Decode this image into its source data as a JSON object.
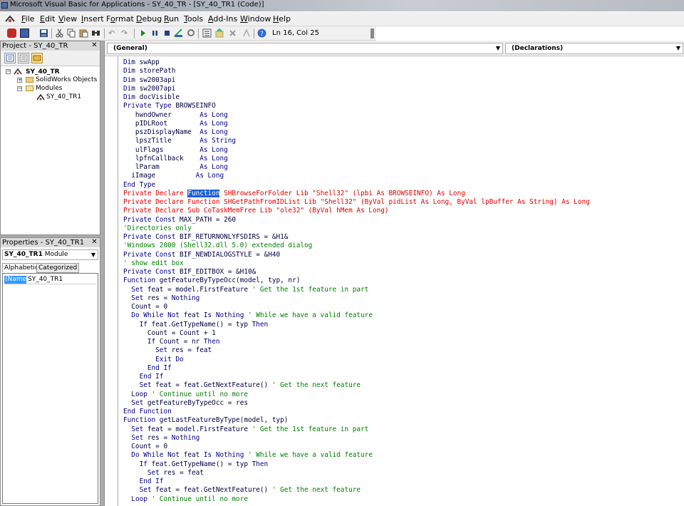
{
  "window": {
    "title": "Microsoft Visual Basic for Applications - SY_40_TR - [SY_40_TR1 (Code)]"
  },
  "menu": [
    {
      "label": "File",
      "underline": "F",
      "rest": "ile"
    },
    {
      "label": "Edit",
      "underline": "E",
      "rest": "dit"
    },
    {
      "label": "View",
      "underline": "V",
      "rest": "iew"
    },
    {
      "label": "Insert",
      "underline": "I",
      "rest": "nsert"
    },
    {
      "label": "Format",
      "underline": "o",
      "rest": ""
    },
    {
      "label": "Debug",
      "underline": "D",
      "rest": "ebug"
    },
    {
      "label": "Run",
      "underline": "R",
      "rest": "un"
    },
    {
      "label": "Tools",
      "underline": "T",
      "rest": "ools"
    },
    {
      "label": "Add-Ins",
      "underline": "A",
      "rest": "dd-Ins"
    },
    {
      "label": "Window",
      "underline": "W",
      "rest": "indow"
    },
    {
      "label": "Help",
      "underline": "H",
      "rest": "elp"
    }
  ],
  "toolbar": {
    "cursor_position": "Ln 16, Col 25",
    "icons": [
      "solidworks-icon",
      "view-object-icon",
      "save-icon",
      "cut-icon",
      "copy-icon",
      "paste-icon",
      "find-icon",
      "undo-icon",
      "redo-icon",
      "run-icon",
      "break-icon",
      "reset-icon",
      "design-mode-icon",
      "project-explorer-icon",
      "properties-icon",
      "object-browser-icon",
      "toolbox-icon",
      "help-icon"
    ]
  },
  "project_pane": {
    "title": "Project - SY_40_TR",
    "tree": {
      "root": "SY_40_TR",
      "solidworks_objects": "SolidWorks Objects",
      "modules": "Modules",
      "module_item": "SY_40_TR1"
    }
  },
  "properties_pane": {
    "title": "Properties - SY_40_TR1",
    "object_name": "SY_40_TR1",
    "object_type": " Module",
    "tabs": [
      "Alphabetic",
      "Categorized"
    ],
    "property_name": "(Name)",
    "property_value": "SY_40_TR1"
  },
  "code_window": {
    "object_combo": "(General)",
    "procedure_combo": "(Declarations)",
    "lines": [
      [
        {
          "t": "Dim",
          "c": "kw"
        },
        {
          "t": " swApp"
        }
      ],
      [
        {
          "t": "Dim",
          "c": "kw"
        },
        {
          "t": " storePath"
        }
      ],
      [
        {
          "t": "Dim",
          "c": "kw"
        },
        {
          "t": " sw2003api"
        }
      ],
      [
        {
          "t": "Dim",
          "c": "kw"
        },
        {
          "t": " sw2007api"
        }
      ],
      [
        {
          "t": "Dim",
          "c": "kw"
        },
        {
          "t": " docVisible"
        }
      ],
      [
        {
          "t": "Private Type",
          "c": "kw"
        },
        {
          "t": " BROWSEINFO"
        }
      ],
      [
        {
          "t": "   hwndOwner       "
        },
        {
          "t": "As Long",
          "c": "kw"
        }
      ],
      [
        {
          "t": "   pIDLRoot        "
        },
        {
          "t": "As Long",
          "c": "kw"
        }
      ],
      [
        {
          "t": "   pszDisplayName  "
        },
        {
          "t": "As Long",
          "c": "kw"
        }
      ],
      [
        {
          "t": "   lpszTitle       "
        },
        {
          "t": "As String",
          "c": "kw"
        }
      ],
      [
        {
          "t": "   ulFlags         "
        },
        {
          "t": "As Long",
          "c": "kw"
        }
      ],
      [
        {
          "t": "   lpfnCallback    "
        },
        {
          "t": "As Long",
          "c": "kw"
        }
      ],
      [
        {
          "t": "   lParam          "
        },
        {
          "t": "As Long",
          "c": "kw"
        }
      ],
      [
        {
          "t": "  iImage          "
        },
        {
          "t": "As Long",
          "c": "kw"
        }
      ],
      [
        {
          "t": "End Type",
          "c": "kw"
        }
      ],
      [
        {
          "t": "Private Declare ",
          "c": "er"
        },
        {
          "t": "Function",
          "c": "sel"
        },
        {
          "t": " SHBrowseForFolder Lib \"Shell32\" (lpbi As BROWSEINFO) As Long",
          "c": "er"
        }
      ],
      [
        {
          "t": "Private Declare Function SHGetPathFromIDList Lib \"Shell32\" (ByVal pidList As Long, ByVal lpBuffer As String) As Long",
          "c": "er"
        }
      ],
      [
        {
          "t": "Private Declare Sub CoTaskMemFree Lib \"ole32\" (ByVal hMem As Long)",
          "c": "er"
        }
      ],
      [
        {
          "t": "Private Const",
          "c": "kw"
        },
        {
          "t": " MAX_PATH = 260"
        }
      ],
      [
        {
          "t": "'Directories only",
          "c": "cm"
        }
      ],
      [
        {
          "t": "Private Const",
          "c": "kw"
        },
        {
          "t": " BIF_RETURNONLYFSDIRS = &H1&"
        }
      ],
      [
        {
          "t": "'Windows 2000 (Shell32.dll 5.0) extended dialog",
          "c": "cm"
        }
      ],
      [
        {
          "t": "Private Const",
          "c": "kw"
        },
        {
          "t": " BIF_NEWDIALOGSTYLE = &H40"
        }
      ],
      [
        {
          "t": "' show edit box",
          "c": "cm"
        }
      ],
      [
        {
          "t": "Private Const",
          "c": "kw"
        },
        {
          "t": " BIF_EDITBOX = &H10&"
        }
      ],
      [
        {
          "t": "Function",
          "c": "kw"
        },
        {
          "t": " getFeatureByTypeOcc(model, typ, nr)"
        }
      ],
      [
        {
          "t": "  "
        },
        {
          "t": "Set",
          "c": "kw"
        },
        {
          "t": " feat = model.FirstFeature "
        },
        {
          "t": "' Get the 1st feature in part",
          "c": "cm"
        }
      ],
      [
        {
          "t": "  "
        },
        {
          "t": "Set",
          "c": "kw"
        },
        {
          "t": " res = "
        },
        {
          "t": "Nothing",
          "c": "kw"
        }
      ],
      [
        {
          "t": "  Count = 0"
        }
      ],
      [
        {
          "t": "  "
        },
        {
          "t": "Do While Not",
          "c": "kw"
        },
        {
          "t": " feat "
        },
        {
          "t": "Is Nothing",
          "c": "kw"
        },
        {
          "t": " ' While we have a valid feature",
          "c": "cm"
        }
      ],
      [
        {
          "t": "    "
        },
        {
          "t": "If",
          "c": "kw"
        },
        {
          "t": " feat.GetTypeName() = typ "
        },
        {
          "t": "Then",
          "c": "kw"
        }
      ],
      [
        {
          "t": "      Count = Count + 1"
        }
      ],
      [
        {
          "t": "      "
        },
        {
          "t": "If",
          "c": "kw"
        },
        {
          "t": " Count = nr "
        },
        {
          "t": "Then",
          "c": "kw"
        }
      ],
      [
        {
          "t": "        "
        },
        {
          "t": "Set",
          "c": "kw"
        },
        {
          "t": " res = feat"
        }
      ],
      [
        {
          "t": "        "
        },
        {
          "t": "Exit Do",
          "c": "kw"
        }
      ],
      [
        {
          "t": "      "
        },
        {
          "t": "End If",
          "c": "kw"
        }
      ],
      [
        {
          "t": "    "
        },
        {
          "t": "End If",
          "c": "kw"
        }
      ],
      [
        {
          "t": "    "
        },
        {
          "t": "Set",
          "c": "kw"
        },
        {
          "t": " feat = feat.GetNextFeature() "
        },
        {
          "t": "' Get the next feature",
          "c": "cm"
        }
      ],
      [
        {
          "t": "  "
        },
        {
          "t": "Loop",
          "c": "kw"
        },
        {
          "t": " ' Continue until no more",
          "c": "cm"
        }
      ],
      [
        {
          "t": "  "
        },
        {
          "t": "Set",
          "c": "kw"
        },
        {
          "t": " getFeatureByTypeOcc = res"
        }
      ],
      [
        {
          "t": "End Function",
          "c": "kw"
        }
      ],
      [
        {
          "t": "Function",
          "c": "kw"
        },
        {
          "t": " getLastFeatureByType(model, typ)"
        }
      ],
      [
        {
          "t": "  "
        },
        {
          "t": "Set",
          "c": "kw"
        },
        {
          "t": " feat = model.FirstFeature "
        },
        {
          "t": "' Get the 1st feature in part",
          "c": "cm"
        }
      ],
      [
        {
          "t": "  "
        },
        {
          "t": "Set",
          "c": "kw"
        },
        {
          "t": " res = "
        },
        {
          "t": "Nothing",
          "c": "kw"
        }
      ],
      [
        {
          "t": "  Count = 0"
        }
      ],
      [
        {
          "t": "  "
        },
        {
          "t": "Do While Not",
          "c": "kw"
        },
        {
          "t": " feat "
        },
        {
          "t": "Is Nothing",
          "c": "kw"
        },
        {
          "t": " ' While we have a valid feature",
          "c": "cm"
        }
      ],
      [
        {
          "t": "    "
        },
        {
          "t": "If",
          "c": "kw"
        },
        {
          "t": " feat.GetTypeName() = typ "
        },
        {
          "t": "Then",
          "c": "kw"
        }
      ],
      [
        {
          "t": "      "
        },
        {
          "t": "Set",
          "c": "kw"
        },
        {
          "t": " res = feat"
        }
      ],
      [
        {
          "t": "    "
        },
        {
          "t": "End If",
          "c": "kw"
        }
      ],
      [
        {
          "t": "    "
        },
        {
          "t": "Set",
          "c": "kw"
        },
        {
          "t": " feat = feat.GetNextFeature() "
        },
        {
          "t": "' Get the next feature",
          "c": "cm"
        }
      ],
      [
        {
          "t": "  "
        },
        {
          "t": "Loop",
          "c": "kw"
        },
        {
          "t": " ' Continue until no more",
          "c": "cm"
        }
      ]
    ]
  },
  "colors": {
    "keyword": "#00007f",
    "comment": "#008000",
    "error": "#e00000",
    "selection": "#1c5fd6"
  }
}
